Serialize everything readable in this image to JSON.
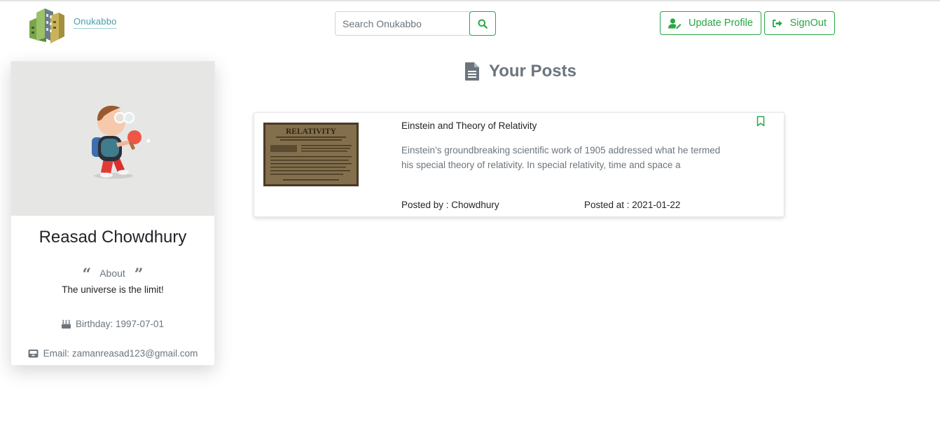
{
  "brand": {
    "name": "Onukabbo"
  },
  "search": {
    "placeholder": "Search Onukabbo",
    "icon": "search-icon"
  },
  "header": {
    "update_profile_label": "Update Profile",
    "signout_label": "SignOut",
    "accent_color": "#28a745"
  },
  "profile": {
    "name": "Reasad Chowdhury",
    "about_label": "About",
    "about_text": "The universe is the limit!",
    "birthday": "Birthday: 1997-07-01",
    "email": "Email: zamanreasad123@gmail.com"
  },
  "posts": {
    "heading": "Your Posts",
    "items": [
      {
        "title": "Einstein and Theory of Relativity",
        "excerpt": "Einstein’s groundbreaking scientific work of 1905 addressed what he termed his special theory of relativity. In special relativity, time and space a",
        "posted_by": "Posted by : Chowdhury",
        "posted_at": "Posted at : 2021-01-22",
        "thumbnail_text": "RELATIVITY"
      }
    ]
  }
}
